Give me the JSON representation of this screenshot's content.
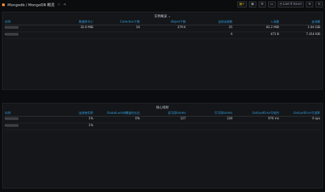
{
  "header": {
    "title": "Mongodb / MongoDB 概览",
    "time_range": "Last 6 hours",
    "icons": [
      "star-icon",
      "share-icon",
      "add-panel-icon",
      "save-icon",
      "settings-icon",
      "tv-icon",
      "clock-icon",
      "zoom-out-icon",
      "refresh-icon"
    ]
  },
  "panel1": {
    "title": "实例概览 ⌄",
    "columns": [
      "实例",
      "数据库大小",
      "Collection个数",
      "Object个数",
      "当前连接数",
      "入流量",
      "出流量"
    ],
    "rows": [
      {
        "name": "sme",
        "db_size": "32.6 MiB",
        "collections": "16",
        "objects": "379 K",
        "connections": "35",
        "in": "81.2 MiB",
        "out": "1.04 GiB"
      },
      {
        "name": "sme",
        "db_size": "",
        "collections": "",
        "objects": "",
        "connections": "4",
        "in": "471 B",
        "out": "7.414 KiB"
      }
    ]
  },
  "panel2": {
    "title": "核心指标",
    "columns": [
      "实例",
      "连接使用率",
      "GlobalLock的覆盖时长比",
      "读可用tickets",
      "写可用tickets",
      "GetLastError写耗时",
      "GetLastError写速率"
    ],
    "rows": [
      {
        "name": "sme",
        "conn_usage": "1%",
        "global_lock": "0%",
        "read_tickets": "127",
        "write_tickets": "128",
        "gle_time": "976 ms",
        "gle_rate": "0 ops"
      },
      {
        "name": "sme",
        "conn_usage": "1%",
        "global_lock": "",
        "read_tickets": "",
        "write_tickets": "",
        "gle_time": "",
        "gle_rate": ""
      }
    ]
  }
}
